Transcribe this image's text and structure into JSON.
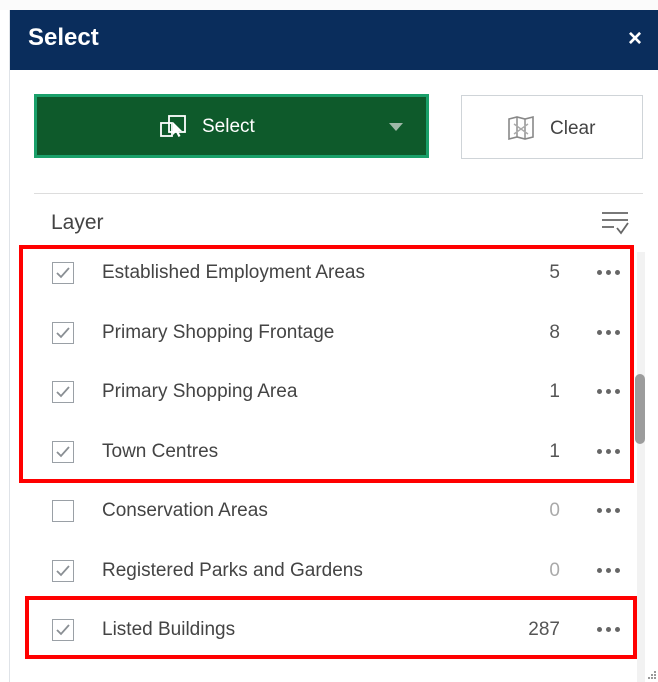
{
  "panel": {
    "title": "Select",
    "close_glyph": "×"
  },
  "toolbar": {
    "select_label": "Select",
    "select_icon": "select-by-rectangle-icon",
    "select_caret": "chevron-down-icon",
    "clear_label": "Clear",
    "clear_icon": "clear-selection-icon"
  },
  "layers": {
    "header": "Layer",
    "filter_icon": "filter-list-icon",
    "items": [
      {
        "name": "Established Employment Areas",
        "count": "5",
        "checked": true
      },
      {
        "name": "Primary Shopping Frontage",
        "count": "8",
        "checked": true
      },
      {
        "name": "Primary Shopping Area",
        "count": "1",
        "checked": true
      },
      {
        "name": "Town Centres",
        "count": "1",
        "checked": true
      },
      {
        "name": "Conservation Areas",
        "count": "0",
        "checked": false
      },
      {
        "name": "Registered Parks and Gardens",
        "count": "0",
        "checked": true
      },
      {
        "name": "Listed Buildings",
        "count": "287",
        "checked": true
      }
    ]
  },
  "colors": {
    "titlebar": "#0a2d5c",
    "select_button": "#0e5a2b",
    "select_button_border": "#1aa06a",
    "highlight": "#ff0000"
  }
}
